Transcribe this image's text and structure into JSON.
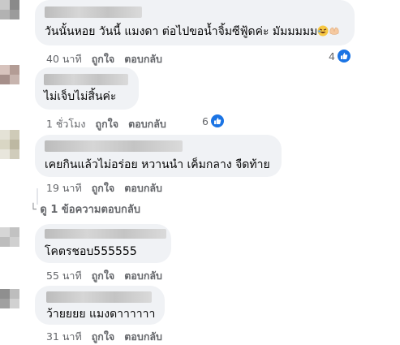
{
  "comments": [
    {
      "text": "วันนั้นหอย วันนี้ แมงดา ต่อไปขอน้ำจิ้มซีฟู้ดค่ะ มัมมมมม",
      "emojis": [
        "rolling-laughing-emoji",
        "heart-hands-emoji"
      ],
      "time": "40 นาที",
      "like_label": "ถูกใจ",
      "reply_label": "ตอบกลับ",
      "reaction_count": "4",
      "reaction_color": "#1b74e4"
    },
    {
      "text": "ไม่เจ็บไม่สิ้นค่ะ",
      "time": "1 ชั่วโมง",
      "like_label": "ถูกใจ",
      "reply_label": "ตอบกลับ",
      "reaction_count": "6",
      "reaction_color": "#1b74e4"
    },
    {
      "text": "เคยกินแล้วไม่อร่อย หวานนำ เค็มกลาง จืดท้าย",
      "time": "19 นาที",
      "like_label": "ถูกใจ",
      "reply_label": "ตอบกลับ",
      "replies_link": "ดู 1 ข้อความตอบกลับ"
    },
    {
      "text": "โคตรชอบ555555",
      "time": "55 นาที",
      "like_label": "ถูกใจ",
      "reply_label": "ตอบกลับ"
    },
    {
      "text": "ว้ายยยย แมงดาาาาาา",
      "time": "31 นาที",
      "like_label": "ถูกใจ",
      "reply_label": "ตอบกลับ"
    }
  ]
}
